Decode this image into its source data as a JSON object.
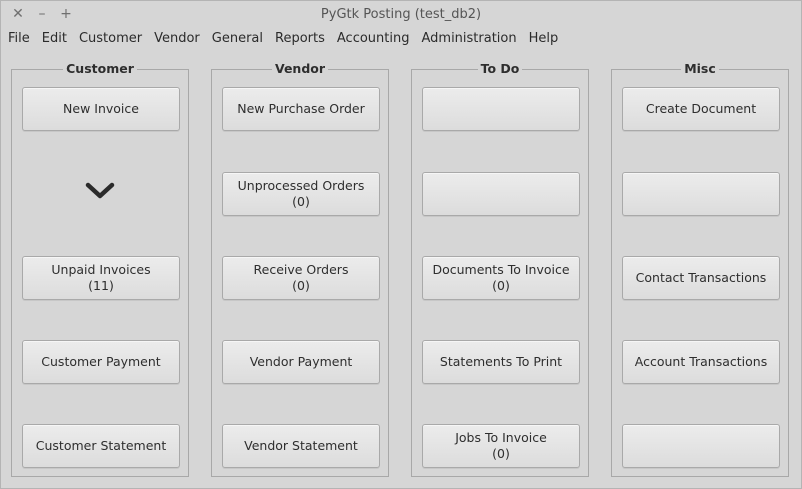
{
  "window": {
    "title": "PyGtk Posting (test_db2)",
    "controls": {
      "close": "✕",
      "minimize": "–",
      "maximize": "+"
    }
  },
  "menu": [
    "File",
    "Edit",
    "Customer",
    "Vendor",
    "General",
    "Reports",
    "Accounting",
    "Administration",
    "Help"
  ],
  "frames": {
    "customer": {
      "title": "Customer",
      "buttons": [
        {
          "label": "New Invoice",
          "count": ""
        },
        {
          "label": "Unpaid Invoices",
          "count": "(11)"
        },
        {
          "label": "Customer Payment",
          "count": ""
        },
        {
          "label": "Customer Statement",
          "count": ""
        }
      ],
      "expander_icon": "chevron-down-icon"
    },
    "vendor": {
      "title": "Vendor",
      "buttons": [
        {
          "label": "New Purchase Order",
          "count": ""
        },
        {
          "label": "Unprocessed Orders",
          "count": "(0)"
        },
        {
          "label": "Receive Orders",
          "count": "(0)"
        },
        {
          "label": "Vendor Payment",
          "count": ""
        },
        {
          "label": "Vendor Statement",
          "count": ""
        }
      ]
    },
    "todo": {
      "title": "To Do",
      "buttons": [
        {
          "label": "",
          "count": ""
        },
        {
          "label": "",
          "count": ""
        },
        {
          "label": "Documents To Invoice",
          "count": "(0)"
        },
        {
          "label": "Statements To Print",
          "count": ""
        },
        {
          "label": "Jobs To Invoice",
          "count": "(0)"
        }
      ]
    },
    "misc": {
      "title": "Misc",
      "buttons": [
        {
          "label": "Create Document",
          "count": ""
        },
        {
          "label": "",
          "count": ""
        },
        {
          "label": "Contact Transactions",
          "count": ""
        },
        {
          "label": "Account Transactions",
          "count": ""
        },
        {
          "label": "",
          "count": ""
        }
      ]
    }
  }
}
